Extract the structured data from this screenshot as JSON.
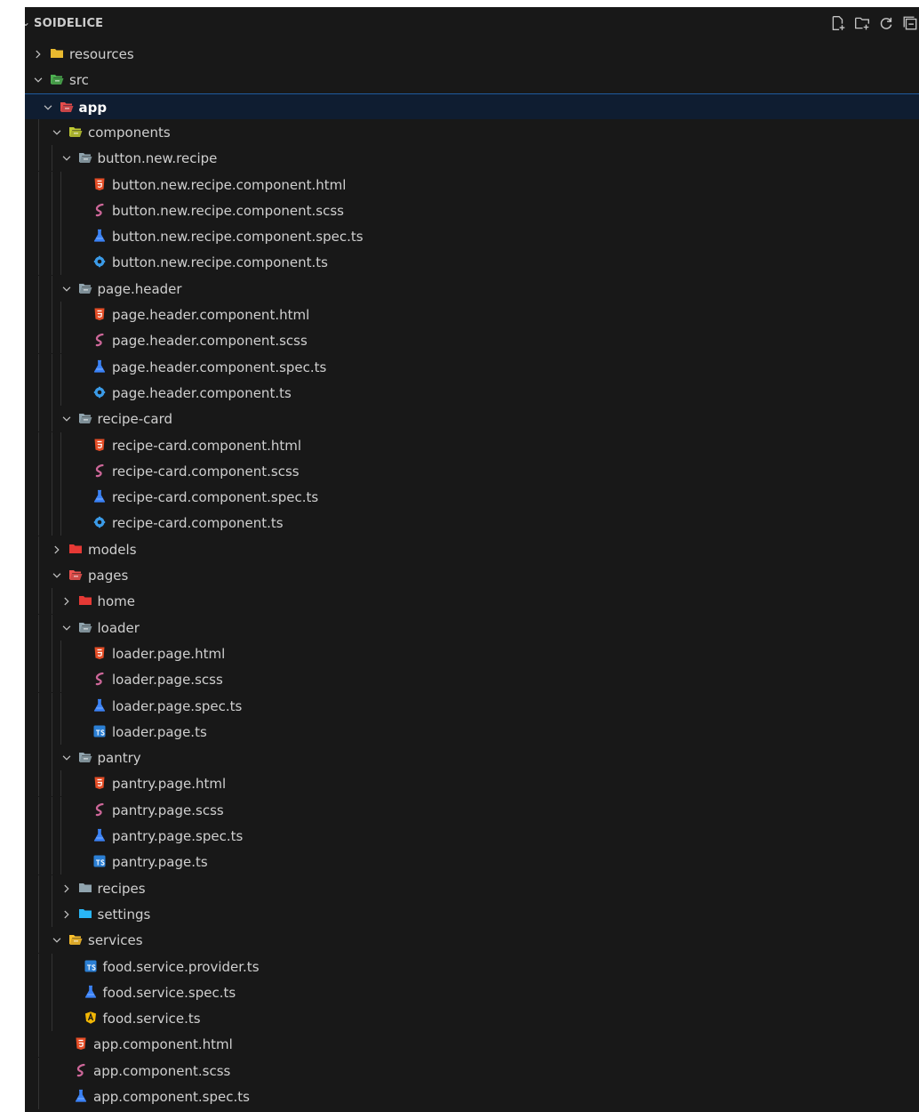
{
  "explorer": {
    "title": "SOIDELICE",
    "actions": [
      {
        "name": "new-file-icon"
      },
      {
        "name": "new-folder-icon"
      },
      {
        "name": "refresh-icon"
      },
      {
        "name": "collapse-all-icon"
      }
    ]
  },
  "colors": {
    "background": "#181818",
    "selection": "#0f1d31",
    "selection_border": "#1f5a9e",
    "html": "#e44d26",
    "scss": "#cd6799",
    "spec": "#3b82f6",
    "angular_ts": "#3b9be8",
    "ts": "#2b7fd4",
    "service_ts": "#f2b705"
  },
  "tree": [
    {
      "label": "resources",
      "depth": 0,
      "kind": "folder",
      "color": "#e8b92f",
      "expanded": false
    },
    {
      "label": "src",
      "depth": 0,
      "kind": "folder",
      "color": "#4caf50",
      "expanded": true
    },
    {
      "label": "app",
      "depth": 1,
      "kind": "folder",
      "color": "#e54b4b",
      "expanded": true,
      "selected": true
    },
    {
      "label": "components",
      "depth": 2,
      "kind": "folder",
      "color": "#c0ca33",
      "expanded": true
    },
    {
      "label": "button.new.recipe",
      "depth": 3,
      "kind": "folder",
      "color": "#90a4ae",
      "expanded": true
    },
    {
      "label": "button.new.recipe.component.html",
      "depth": 4,
      "kind": "html"
    },
    {
      "label": "button.new.recipe.component.scss",
      "depth": 4,
      "kind": "scss"
    },
    {
      "label": "button.new.recipe.component.spec.ts",
      "depth": 4,
      "kind": "spec"
    },
    {
      "label": "button.new.recipe.component.ts",
      "depth": 4,
      "kind": "angular"
    },
    {
      "label": "page.header",
      "depth": 3,
      "kind": "folder",
      "color": "#90a4ae",
      "expanded": true
    },
    {
      "label": "page.header.component.html",
      "depth": 4,
      "kind": "html"
    },
    {
      "label": "page.header.component.scss",
      "depth": 4,
      "kind": "scss"
    },
    {
      "label": "page.header.component.spec.ts",
      "depth": 4,
      "kind": "spec"
    },
    {
      "label": "page.header.component.ts",
      "depth": 4,
      "kind": "angular"
    },
    {
      "label": "recipe-card",
      "depth": 3,
      "kind": "folder",
      "color": "#90a4ae",
      "expanded": true
    },
    {
      "label": "recipe-card.component.html",
      "depth": 4,
      "kind": "html"
    },
    {
      "label": "recipe-card.component.scss",
      "depth": 4,
      "kind": "scss"
    },
    {
      "label": "recipe-card.component.spec.ts",
      "depth": 4,
      "kind": "spec"
    },
    {
      "label": "recipe-card.component.ts",
      "depth": 4,
      "kind": "angular"
    },
    {
      "label": "models",
      "depth": 2,
      "kind": "folder",
      "color": "#e53935",
      "expanded": false
    },
    {
      "label": "pages",
      "depth": 2,
      "kind": "folder",
      "color": "#ef5350",
      "expanded": true
    },
    {
      "label": "home",
      "depth": 3,
      "kind": "folder",
      "color": "#e53935",
      "expanded": false
    },
    {
      "label": "loader",
      "depth": 3,
      "kind": "folder",
      "color": "#90a4ae",
      "expanded": true
    },
    {
      "label": "loader.page.html",
      "depth": 4,
      "kind": "html"
    },
    {
      "label": "loader.page.scss",
      "depth": 4,
      "kind": "scss"
    },
    {
      "label": "loader.page.spec.ts",
      "depth": 4,
      "kind": "spec"
    },
    {
      "label": "loader.page.ts",
      "depth": 4,
      "kind": "ts"
    },
    {
      "label": "pantry",
      "depth": 3,
      "kind": "folder",
      "color": "#90a4ae",
      "expanded": true
    },
    {
      "label": "pantry.page.html",
      "depth": 4,
      "kind": "html"
    },
    {
      "label": "pantry.page.scss",
      "depth": 4,
      "kind": "scss"
    },
    {
      "label": "pantry.page.spec.ts",
      "depth": 4,
      "kind": "spec"
    },
    {
      "label": "pantry.page.ts",
      "depth": 4,
      "kind": "ts"
    },
    {
      "label": "recipes",
      "depth": 3,
      "kind": "folder",
      "color": "#90a4ae",
      "expanded": false
    },
    {
      "label": "settings",
      "depth": 3,
      "kind": "folder",
      "color": "#29b6f6",
      "expanded": false
    },
    {
      "label": "services",
      "depth": 2,
      "kind": "folder",
      "color": "#fbc02d",
      "expanded": true
    },
    {
      "label": "food.service.provider.ts",
      "depth": 3,
      "kind": "ts"
    },
    {
      "label": "food.service.spec.ts",
      "depth": 3,
      "kind": "spec"
    },
    {
      "label": "food.service.ts",
      "depth": 3,
      "kind": "service"
    },
    {
      "label": "app.component.html",
      "depth": 2,
      "kind": "html"
    },
    {
      "label": "app.component.scss",
      "depth": 2,
      "kind": "scss"
    },
    {
      "label": "app.component.spec.ts",
      "depth": 2,
      "kind": "spec"
    }
  ]
}
